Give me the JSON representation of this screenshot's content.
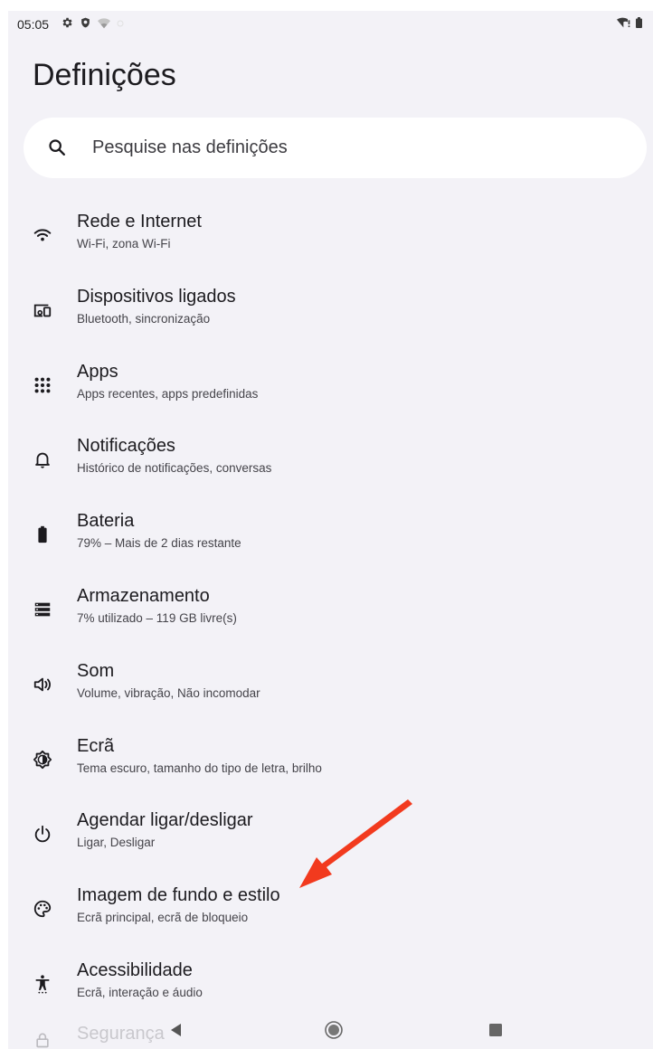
{
  "status_bar": {
    "time": "05:05",
    "left_icons": [
      "gear-icon",
      "shield-icon",
      "wifi-weak-icon",
      "alert-icon"
    ],
    "right_icons": [
      "wifi-alert-icon",
      "battery-icon"
    ]
  },
  "page": {
    "title": "Definições"
  },
  "search": {
    "placeholder": "Pesquise nas definições"
  },
  "settings": {
    "items": [
      {
        "icon": "wifi-icon",
        "title": "Rede e Internet",
        "subtitle": "Wi-Fi, zona Wi-Fi"
      },
      {
        "icon": "devices-icon",
        "title": "Dispositivos ligados",
        "subtitle": "Bluetooth, sincronização"
      },
      {
        "icon": "apps-grid-icon",
        "title": "Apps",
        "subtitle": "Apps recentes, apps predefinidas"
      },
      {
        "icon": "bell-icon",
        "title": "Notificações",
        "subtitle": "Histórico de notificações, conversas"
      },
      {
        "icon": "battery-icon",
        "title": "Bateria",
        "subtitle": "79% – Mais de 2 dias restante"
      },
      {
        "icon": "storage-icon",
        "title": "Armazenamento",
        "subtitle": "7% utilizado – 119 GB livre(s)"
      },
      {
        "icon": "volume-icon",
        "title": "Som",
        "subtitle": "Volume, vibração, Não incomodar"
      },
      {
        "icon": "brightness-icon",
        "title": "Ecrã",
        "subtitle": "Tema escuro, tamanho do tipo de letra, brilho"
      },
      {
        "icon": "power-icon",
        "title": "Agendar ligar/desligar",
        "subtitle": "Ligar, Desligar"
      },
      {
        "icon": "palette-icon",
        "title": "Imagem de fundo e estilo",
        "subtitle": "Ecrã principal, ecrã de bloqueio"
      },
      {
        "icon": "accessibility-icon",
        "title": "Acessibilidade",
        "subtitle": "Ecrã, interação e áudio"
      }
    ],
    "partial_item": {
      "icon": "lock-icon",
      "title": "Segurança"
    }
  },
  "annotation": {
    "arrow_color": "#f23a1e",
    "target": "Imagem de fundo e estilo"
  },
  "nav_bar": {
    "buttons": [
      "back-icon",
      "home-icon",
      "recents-icon"
    ]
  },
  "colors": {
    "background": "#f3f2f7",
    "card": "#ffffff",
    "text_primary": "#1c1b1f",
    "text_secondary": "#45444a"
  }
}
